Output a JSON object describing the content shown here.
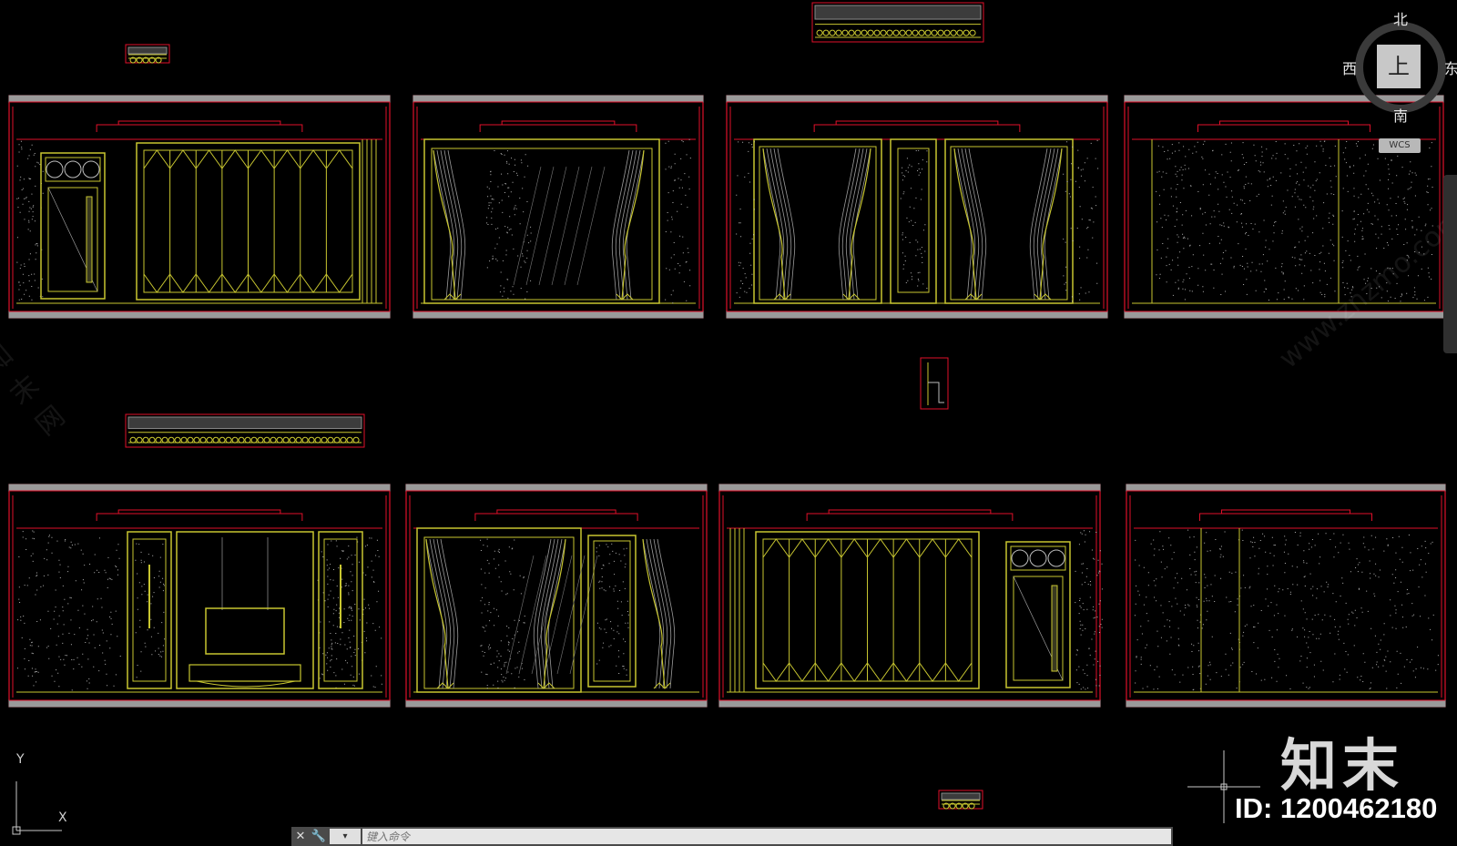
{
  "viewcube": {
    "north": "北",
    "south": "南",
    "west": "西",
    "east": "东",
    "face": "上"
  },
  "wcs": "WCS",
  "ucs": {
    "y": "Y",
    "x": "X"
  },
  "command": {
    "placeholder": "键入命令",
    "close": "✕",
    "customize": "🔧",
    "recent": "▾"
  },
  "watermark": {
    "brand": "知末",
    "id": "ID: 1200462180",
    "site": "www.znzmo.com",
    "cn": "知末网"
  },
  "colors": {
    "frame": "#e0102a",
    "line": "#c8c630",
    "hatch": "#d9d9d9",
    "slab": "#9a9a9a",
    "grid": "#c8c8c8"
  },
  "elevations": [
    {
      "row": 0,
      "type": "folding-door"
    },
    {
      "row": 0,
      "type": "window-curtains"
    },
    {
      "row": 0,
      "type": "double-window-curtains"
    },
    {
      "row": 0,
      "type": "plain-wall"
    },
    {
      "row": 1,
      "type": "tv-wall"
    },
    {
      "row": 1,
      "type": "window-curtains-panel"
    },
    {
      "row": 1,
      "type": "folding-door-mirrored"
    },
    {
      "row": 1,
      "type": "plain-wall-split"
    }
  ]
}
